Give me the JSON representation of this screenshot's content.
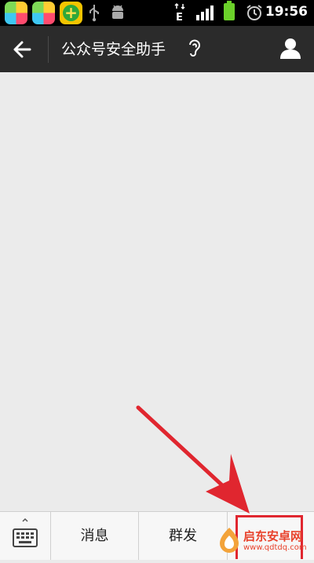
{
  "status_bar": {
    "icons": [
      "colorful-app-icon",
      "colorful-app-icon",
      "360-security-icon",
      "usb-icon",
      "android-debug-icon",
      "network-e-icon",
      "signal-icon",
      "battery-icon",
      "alarm-icon"
    ],
    "network_label": "E",
    "time": "19:56"
  },
  "header": {
    "title": "公众号安全助手",
    "back_icon": "arrow-left-icon",
    "ear_icon": "ear-icon",
    "profile_icon": "person-icon",
    "bg_color": "#2b2b2b"
  },
  "chat": {
    "bg_color": "#ebebeb"
  },
  "bottom_bar": {
    "keyboard_icon": "keyboard-icon",
    "tabs": [
      {
        "label": "消息"
      },
      {
        "label": "群发"
      },
      {
        "label": ""
      }
    ]
  },
  "annotation": {
    "arrow_color": "#e0262f",
    "highlight_color": "#e0262f"
  },
  "watermark": {
    "name": "启东安卓网",
    "url": "www.qdtdq.com"
  }
}
